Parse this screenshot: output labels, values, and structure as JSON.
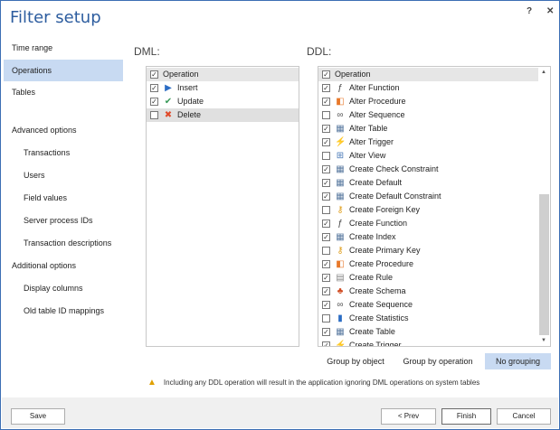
{
  "window": {
    "title": "Filter setup",
    "help": "?",
    "close": "✕"
  },
  "sidebar": {
    "items": [
      {
        "label": "Time range"
      },
      {
        "label": "Operations",
        "selected": true
      },
      {
        "label": "Tables"
      },
      {
        "label": "Advanced options"
      },
      {
        "label": "Transactions"
      },
      {
        "label": "Users"
      },
      {
        "label": "Field values"
      },
      {
        "label": "Server process IDs"
      },
      {
        "label": "Transaction descriptions"
      },
      {
        "label": "Additional options"
      },
      {
        "label": "Display columns"
      },
      {
        "label": "Old table ID mappings"
      }
    ]
  },
  "dml": {
    "label": "DML:",
    "header": "Operation",
    "items": [
      {
        "label": "Insert",
        "checked": true,
        "icon": "play-icon"
      },
      {
        "label": "Update",
        "checked": true,
        "icon": "check-icon"
      },
      {
        "label": "Delete",
        "checked": false,
        "icon": "x-icon"
      }
    ]
  },
  "ddl": {
    "label": "DDL:",
    "header": "Operation",
    "items": [
      {
        "label": "Alter Function",
        "checked": true
      },
      {
        "label": "Alter Procedure",
        "checked": true
      },
      {
        "label": "Alter Sequence",
        "checked": false
      },
      {
        "label": "Alter Table",
        "checked": true
      },
      {
        "label": "Alter Trigger",
        "checked": true
      },
      {
        "label": "Alter View",
        "checked": false
      },
      {
        "label": "Create Check Constraint",
        "checked": true
      },
      {
        "label": "Create Default",
        "checked": true
      },
      {
        "label": "Create Default Constraint",
        "checked": true
      },
      {
        "label": "Create Foreign Key",
        "checked": false
      },
      {
        "label": "Create Function",
        "checked": true
      },
      {
        "label": "Create Index",
        "checked": true
      },
      {
        "label": "Create Primary Key",
        "checked": false
      },
      {
        "label": "Create Procedure",
        "checked": true
      },
      {
        "label": "Create Rule",
        "checked": true
      },
      {
        "label": "Create Schema",
        "checked": true
      },
      {
        "label": "Create Sequence",
        "checked": true
      },
      {
        "label": "Create Statistics",
        "checked": false
      },
      {
        "label": "Create Table",
        "checked": true
      },
      {
        "label": "Create Trigger",
        "checked": true
      }
    ]
  },
  "grouping": {
    "options": [
      "Group by object",
      "Group by operation",
      "No grouping"
    ],
    "selected": "No grouping"
  },
  "warning": "Including any DDL operation will result in the application ignoring DML operations on system tables",
  "footer": {
    "save": "Save",
    "prev": "< Prev",
    "finish": "Finish",
    "cancel": "Cancel"
  }
}
